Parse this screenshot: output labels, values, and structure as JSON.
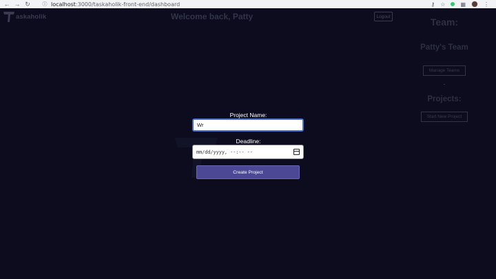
{
  "browser": {
    "url_host": "localhost",
    "url_path": ":3000/taskaholik-front-end/dashboard",
    "back_icon": "arrow-left-icon",
    "forward_icon": "arrow-right-icon",
    "reload_icon": "reload-icon"
  },
  "header": {
    "logo_letter": "T",
    "logo_text": "askaholik",
    "welcome": "Welcome back, Patty",
    "logout_label": "Logout"
  },
  "sidebar": {
    "team_heading": "Team:",
    "team_name": "Patty's Team",
    "manage_teams_label": "Manage Teams",
    "projects_heading": "Projects:",
    "start_project_label": "Start New Project"
  },
  "form": {
    "project_name_label": "Project Name:",
    "project_name_value": "Wr",
    "deadline_label": "Deadline:",
    "deadline_placeholder": "mm/dd/yyyy, --:-- --",
    "create_button_label": "Create Project"
  },
  "colors": {
    "background": "#0c0c1e",
    "button_accent": "#4d4896",
    "focus_border": "#4a70c8"
  }
}
